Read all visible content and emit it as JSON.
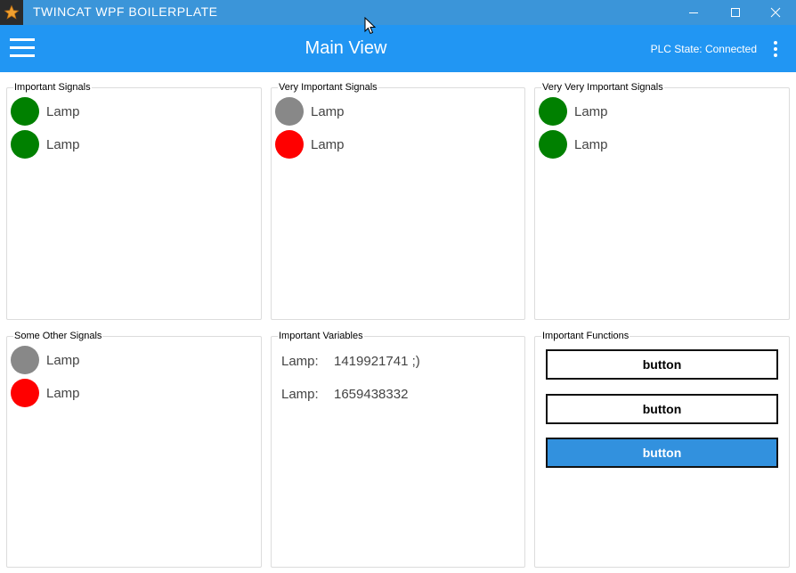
{
  "window": {
    "title": "TWINCAT WPF BOILERPLATE"
  },
  "appbar": {
    "title": "Main View",
    "plc_state": "PLC State: Connected"
  },
  "colors": {
    "green": "#008000",
    "gray": "#888888",
    "red": "#ff0000",
    "accent": "#2196f3",
    "titlebar": "#3b95d9",
    "button_primary": "#3291de"
  },
  "groups": {
    "important_signals": {
      "title": "Important Signals",
      "lamps": [
        {
          "label": "Lamp",
          "color": "green"
        },
        {
          "label": "Lamp",
          "color": "green"
        }
      ]
    },
    "very_important_signals": {
      "title": "Very Important Signals",
      "lamps": [
        {
          "label": "Lamp",
          "color": "gray"
        },
        {
          "label": "Lamp",
          "color": "red"
        }
      ]
    },
    "very_very_important_signals": {
      "title": "Very Very Important Signals",
      "lamps": [
        {
          "label": "Lamp",
          "color": "green"
        },
        {
          "label": "Lamp",
          "color": "green"
        }
      ]
    },
    "some_other_signals": {
      "title": "Some Other Signals",
      "lamps": [
        {
          "label": "Lamp",
          "color": "gray"
        },
        {
          "label": "Lamp",
          "color": "red"
        }
      ]
    },
    "important_variables": {
      "title": "Important Variables",
      "vars": [
        {
          "label": "Lamp:",
          "value": "1419921741 ;)"
        },
        {
          "label": "Lamp:",
          "value": "1659438332"
        }
      ]
    },
    "important_functions": {
      "title": "Important Functions",
      "buttons": [
        {
          "label": "button"
        },
        {
          "label": "button"
        },
        {
          "label": "button"
        }
      ]
    }
  }
}
